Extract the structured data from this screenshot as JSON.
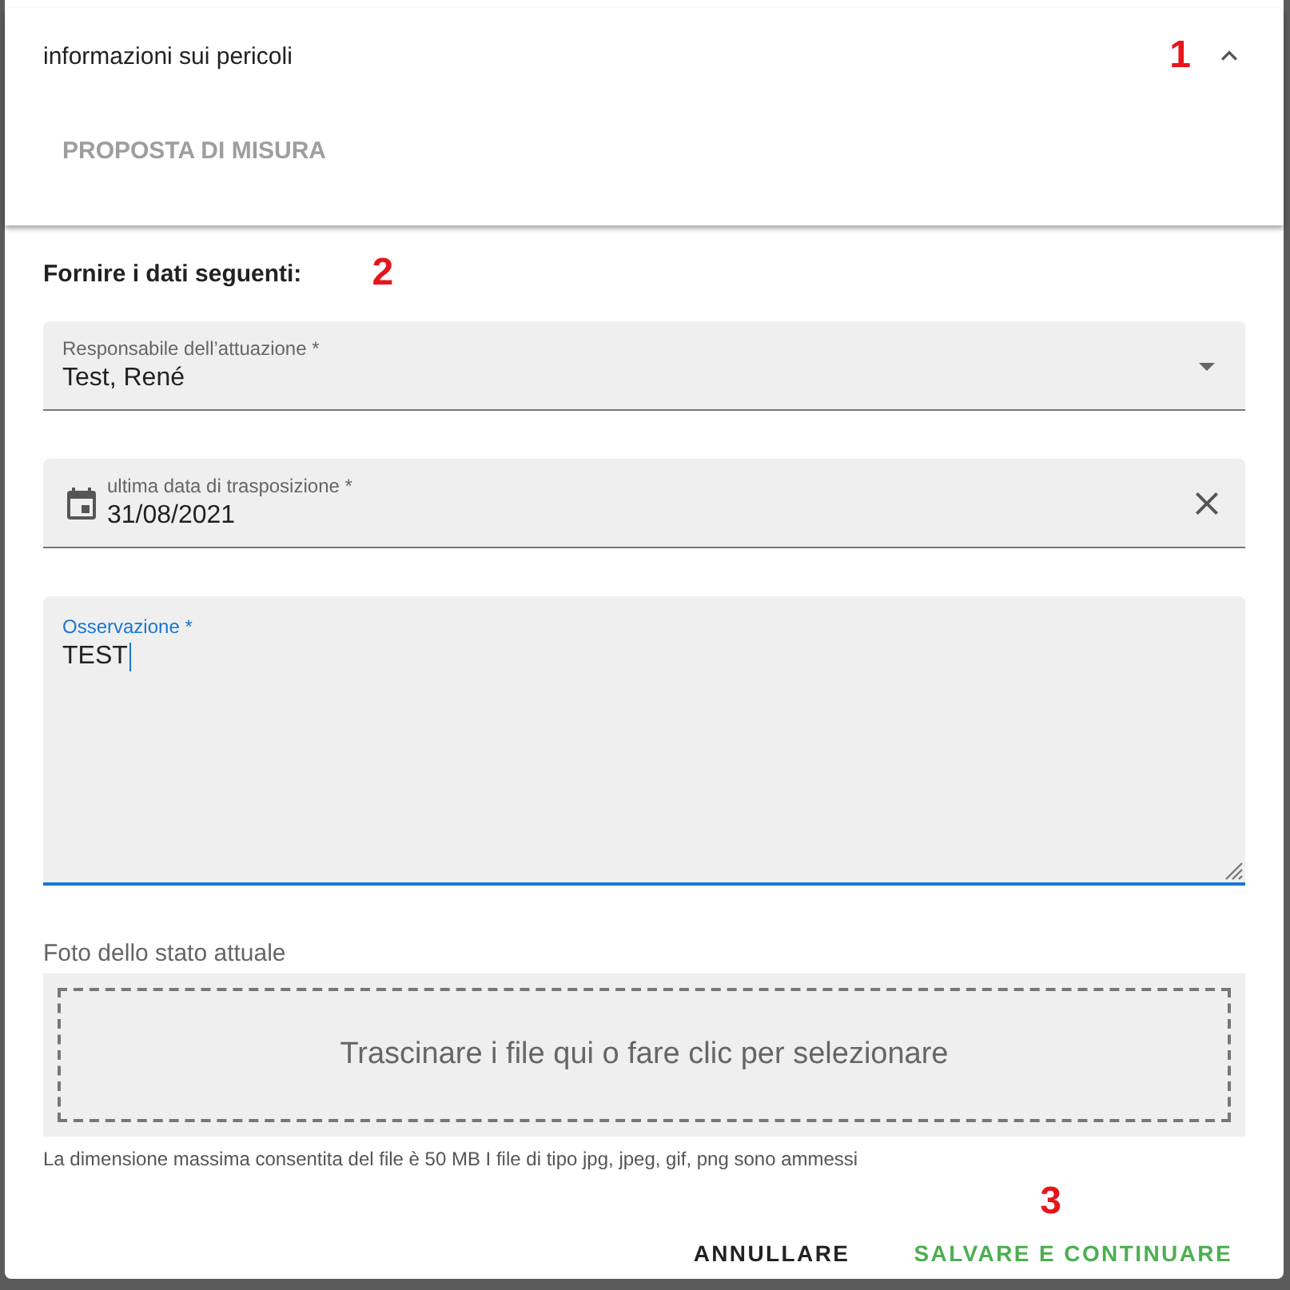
{
  "panel": {
    "title": "informazioni sui pericoli",
    "marker": "1",
    "expanded": true,
    "tab": "PROPOSTA DI MISURA"
  },
  "form": {
    "heading": "Fornire i dati seguenti:",
    "marker": "2",
    "fields": [
      {
        "kind": "select",
        "label": "Responsabile dell’attuazione *",
        "value": "Test, René",
        "focused": false
      },
      {
        "kind": "date",
        "label": "ultima data di trasposizione *",
        "value": "31/08/2021",
        "focused": false
      },
      {
        "kind": "textarea",
        "label": "Osservazione *",
        "value": "TEST",
        "focused": true
      }
    ],
    "upload": {
      "label": "Foto dello stato attuale",
      "placeholder": "Trascinare i file qui o fare clic per selezionare",
      "hint": "La dimensione massima consentita del file è 50 MB I file di tipo jpg, jpeg, gif, png sono ammessi"
    }
  },
  "actions": {
    "marker": "3",
    "buttons": [
      {
        "label": "ANNULLARE",
        "kind": "secondary"
      },
      {
        "label": "SALVARE E CONTINUARE",
        "kind": "primary"
      }
    ]
  }
}
